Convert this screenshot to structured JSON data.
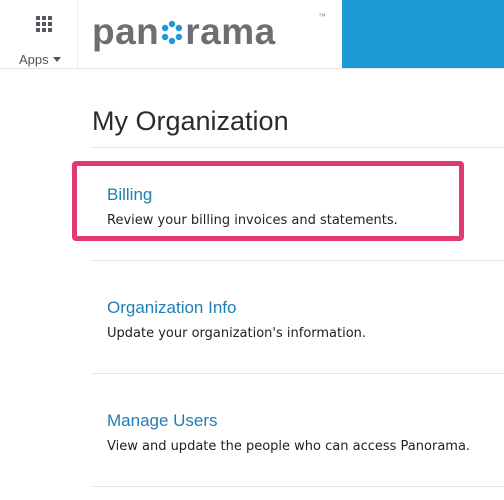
{
  "header": {
    "apps_label": "Apps",
    "logo_text_before": "pan",
    "logo_text_after": "rama",
    "logo_trademark": "™",
    "accent_color": "#1c9ad6"
  },
  "main": {
    "title": "My Organization",
    "items": [
      {
        "title": "Billing",
        "description": "Review your billing invoices and statements."
      },
      {
        "title": "Organization Info",
        "description": "Update your organization's information."
      },
      {
        "title": "Manage Users",
        "description": "View and update the people who can access Panorama."
      }
    ]
  },
  "highlight_color": "#e23a6e"
}
